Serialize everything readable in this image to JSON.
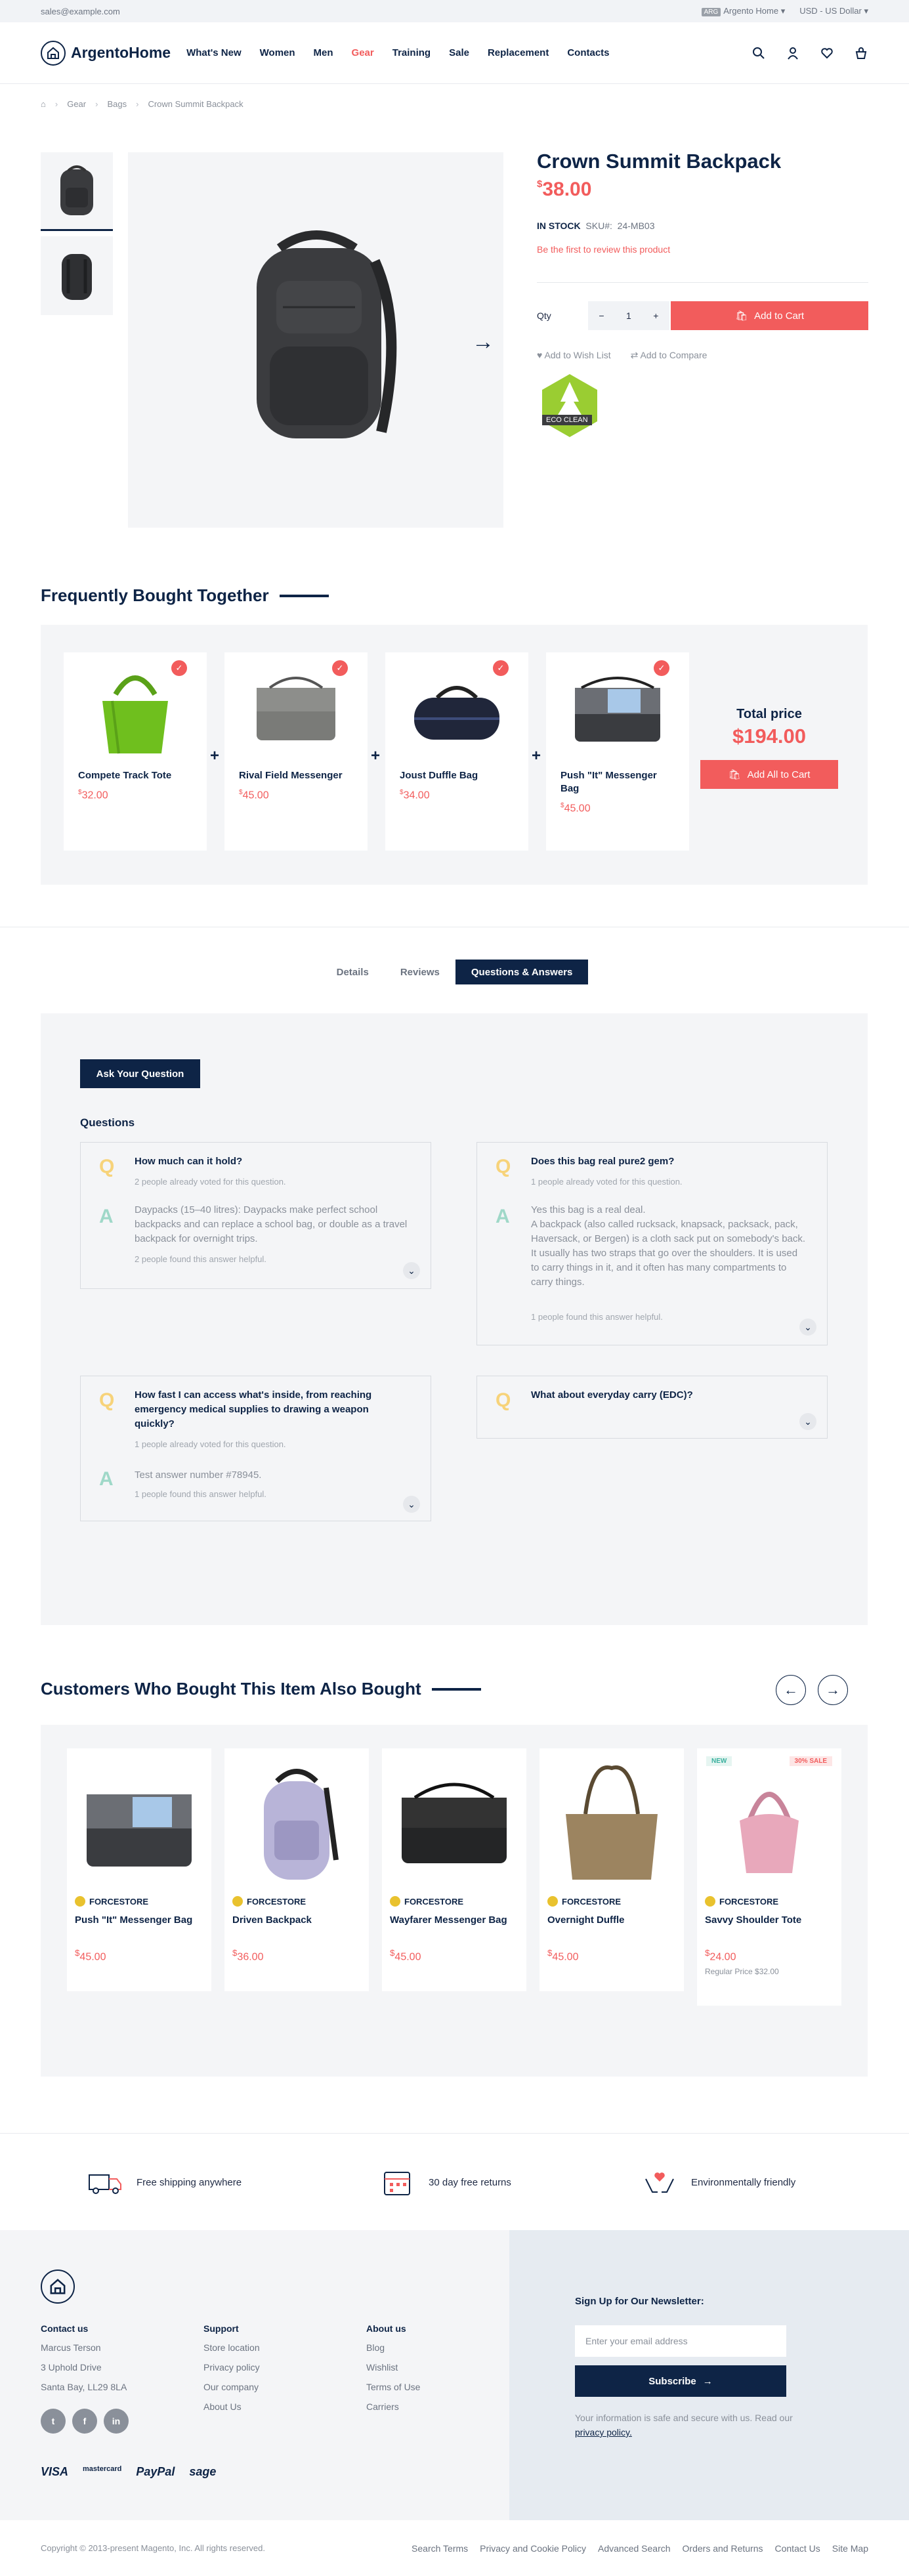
{
  "topbar": {
    "email": "sales@example.com",
    "store_badge": "ARG",
    "store": "Argento Home",
    "currency": "USD - US Dollar"
  },
  "header": {
    "logo": "ArgentoHome",
    "nav": [
      "What's New",
      "Women",
      "Men",
      "Gear",
      "Training",
      "Sale",
      "Replacement",
      "Contacts"
    ],
    "active_index": 3
  },
  "breadcrumb": [
    "Gear",
    "Bags",
    "Crown Summit Backpack"
  ],
  "product": {
    "title": "Crown Summit Backpack",
    "currency_symbol": "$",
    "price": "38.00",
    "stock": "IN STOCK",
    "sku_label": "SKU#:",
    "sku": "24-MB03",
    "review_text": "Be the first to review this product",
    "qty_label": "Qty",
    "qty": "1",
    "add_to_cart": "Add to Cart",
    "wishlist": "Add to Wish List",
    "compare": "Add to Compare",
    "eco_label": "ECO CLEAN"
  },
  "fbt": {
    "title": "Frequently Bought Together",
    "items": [
      {
        "name": "Compete Track Tote",
        "price": "32.00"
      },
      {
        "name": "Rival Field Messenger",
        "price": "45.00"
      },
      {
        "name": "Joust Duffle Bag",
        "price": "34.00"
      },
      {
        "name": "Push \"It\" Messenger Bag",
        "price": "45.00"
      }
    ],
    "total_label": "Total price",
    "total": "$194.00",
    "add_all": "Add All to Cart"
  },
  "tabs": [
    "Details",
    "Reviews",
    "Questions & Answers"
  ],
  "qa": {
    "ask": "Ask Your Question",
    "heading": "Questions",
    "items": [
      {
        "q": "How much can it hold?",
        "votes": "2 people already voted for this question.",
        "a": "Daypacks (15–40 litres): Daypacks make perfect school backpacks and can replace a school bag, or double as a travel backpack for overnight trips.",
        "helpful": "2 people found this answer helpful."
      },
      {
        "q": "Does this bag real pure2 gem?",
        "votes": "1 people already voted for this question.",
        "a": "Yes this bag is a real deal.\nA backpack (also called rucksack, knapsack, packsack, pack, Haversack, or Bergen) is a cloth sack put on somebody's back. It usually has two straps that go over the shoulders. It is used to carry things in it, and it often has many compartments to carry things.",
        "helpful": "1 people found this answer helpful."
      },
      {
        "q": "How fast I can access what's inside, from reaching emergency medical supplies to drawing a weapon quickly?",
        "votes": "1 people already voted for this question.",
        "a": "Test answer number #78945.",
        "helpful": "1 people found this answer helpful."
      },
      {
        "q": "What about everyday carry (EDC)?"
      }
    ]
  },
  "also": {
    "title": "Customers Who Bought This Item Also Bought",
    "brand": "FORCESTORE",
    "items": [
      {
        "name": "Push \"It\" Messenger Bag",
        "price": "45.00"
      },
      {
        "name": "Driven Backpack",
        "price": "36.00"
      },
      {
        "name": "Wayfarer Messenger Bag",
        "price": "45.00"
      },
      {
        "name": "Overnight Duffle",
        "price": "45.00"
      },
      {
        "name": "Savvy Shoulder Tote",
        "price": "24.00",
        "regular": "Regular Price $32.00",
        "new": "NEW",
        "sale": "30% SALE"
      }
    ]
  },
  "benefits": [
    "Free shipping anywhere",
    "30 day free returns",
    "Environmentally friendly"
  ],
  "footer": {
    "contact": {
      "h": "Contact us",
      "lines": [
        "Marcus Terson",
        "3 Uphold Drive",
        "Santa Bay, LL29 8LA"
      ]
    },
    "support": {
      "h": "Support",
      "lines": [
        "Store location",
        "Privacy policy",
        "Our company",
        "About Us"
      ]
    },
    "about": {
      "h": "About us",
      "lines": [
        "Blog",
        "Wishlist",
        "Terms of Use",
        "Carriers"
      ]
    },
    "social": [
      "t",
      "f",
      "in"
    ],
    "payments": [
      "VISA",
      "mastercard",
      "PayPal",
      "sage"
    ],
    "newsletter": {
      "title": "Sign Up for Our Newsletter:",
      "placeholder": "Enter your email address",
      "button": "Subscribe",
      "note": "Your information is safe and secure with us. Read our",
      "policy": "privacy policy."
    }
  },
  "bottom": {
    "copyright": "Copyright © 2013-present Magento, Inc. All rights reserved.",
    "links": [
      "Search Terms",
      "Privacy and Cookie Policy",
      "Advanced Search",
      "Orders and Returns",
      "Contact Us",
      "Site Map"
    ]
  }
}
